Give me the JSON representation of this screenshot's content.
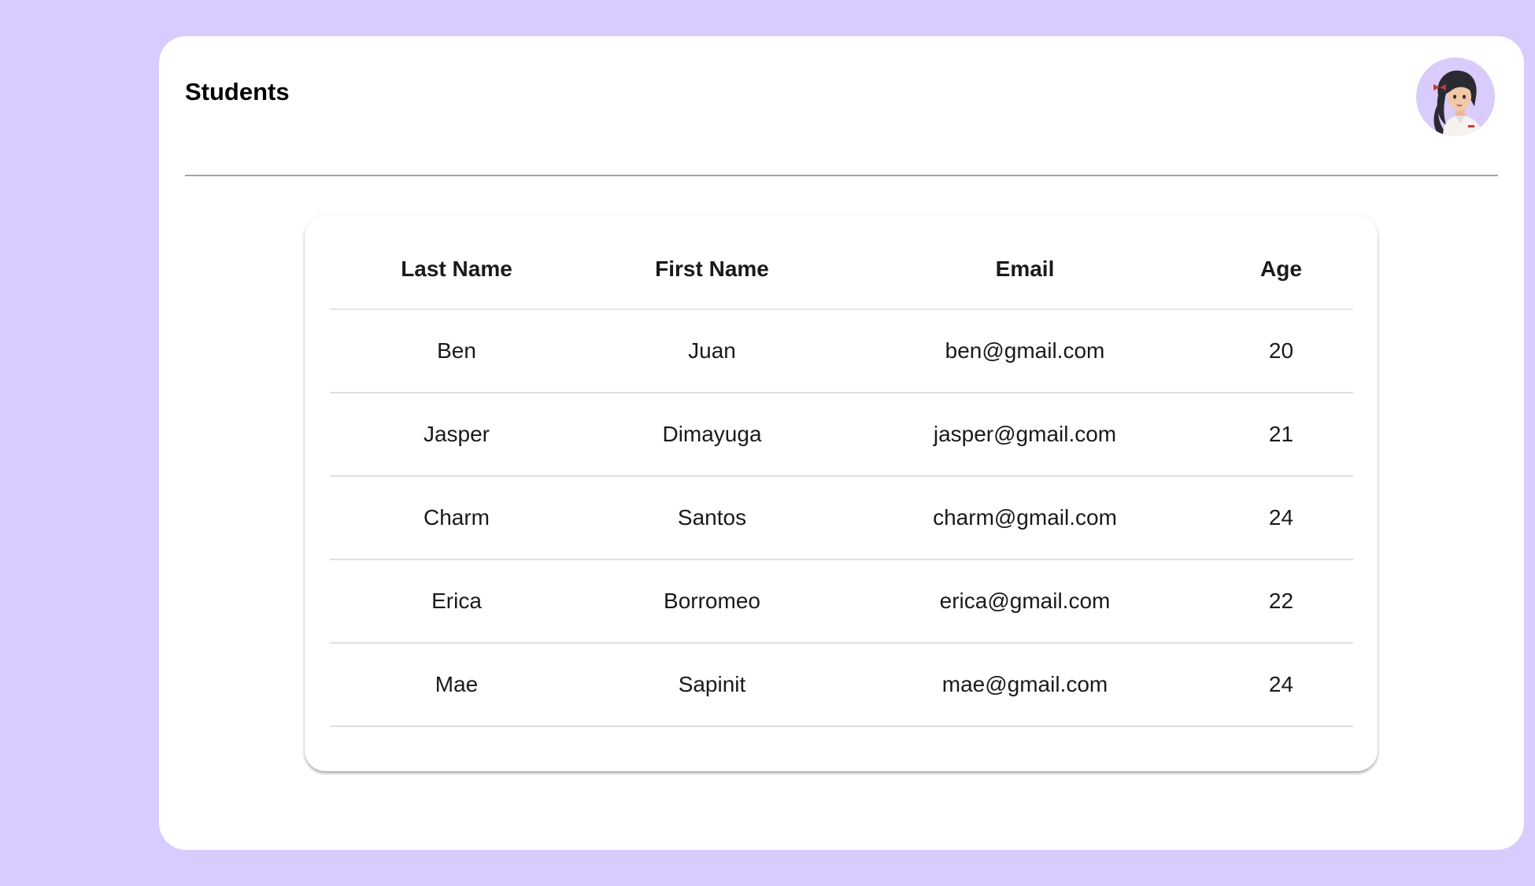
{
  "page": {
    "title": "Students",
    "avatar_icon": "user-avatar-icon",
    "background_color": "#d8cbfd",
    "panel_color": "#ffffff"
  },
  "table": {
    "columns": [
      "Last Name",
      "First Name",
      "Email",
      "Age"
    ],
    "rows": [
      {
        "last_name": "Ben",
        "first_name": "Juan",
        "email": "ben@gmail.com",
        "age": "20"
      },
      {
        "last_name": "Jasper",
        "first_name": "Dimayuga",
        "email": "jasper@gmail.com",
        "age": "21"
      },
      {
        "last_name": "Charm",
        "first_name": "Santos",
        "email": "charm@gmail.com",
        "age": "24"
      },
      {
        "last_name": "Erica",
        "first_name": "Borromeo",
        "email": "erica@gmail.com",
        "age": "22"
      },
      {
        "last_name": "Mae",
        "first_name": "Sapinit",
        "email": "mae@gmail.com",
        "age": "24"
      }
    ]
  }
}
